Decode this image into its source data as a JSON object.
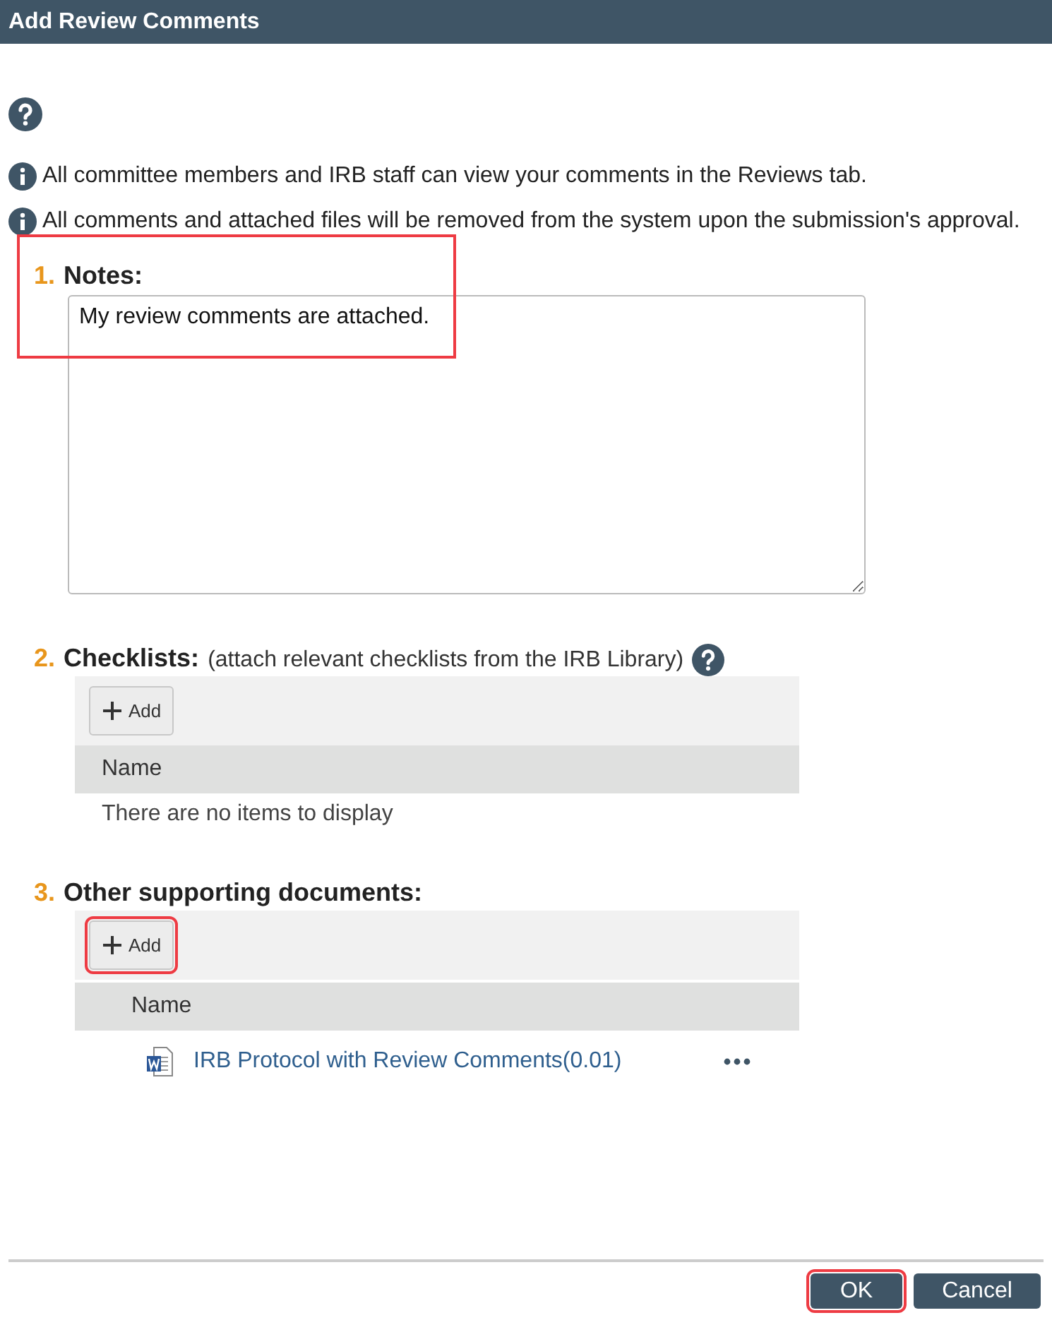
{
  "window": {
    "title": "Add Review Comments"
  },
  "info_lines": [
    "All committee members and IRB staff can view your comments in the Reviews tab.",
    "All comments and attached files will be removed from the system upon the submission's approval."
  ],
  "notes": {
    "number": "1.",
    "label": "Notes:",
    "value": "My review comments are attached.",
    "highlighted": true
  },
  "checklists": {
    "number": "2.",
    "label": "Checklists:",
    "hint": "(attach relevant checklists from the IRB Library)",
    "add_button": {
      "label": "Add",
      "highlighted": false
    },
    "column": "Name",
    "empty_text": "There are no items to display"
  },
  "documents": {
    "number": "3.",
    "label": "Other supporting documents:",
    "add_button": {
      "label": "Add",
      "highlighted": true
    },
    "column": "Name",
    "rows": [
      {
        "name": "IRB Protocol with Review Comments(0.01)"
      }
    ]
  },
  "buttons": [
    {
      "label": "OK",
      "highlighted": true
    },
    {
      "label": "Cancel",
      "highlighted": false
    }
  ]
}
